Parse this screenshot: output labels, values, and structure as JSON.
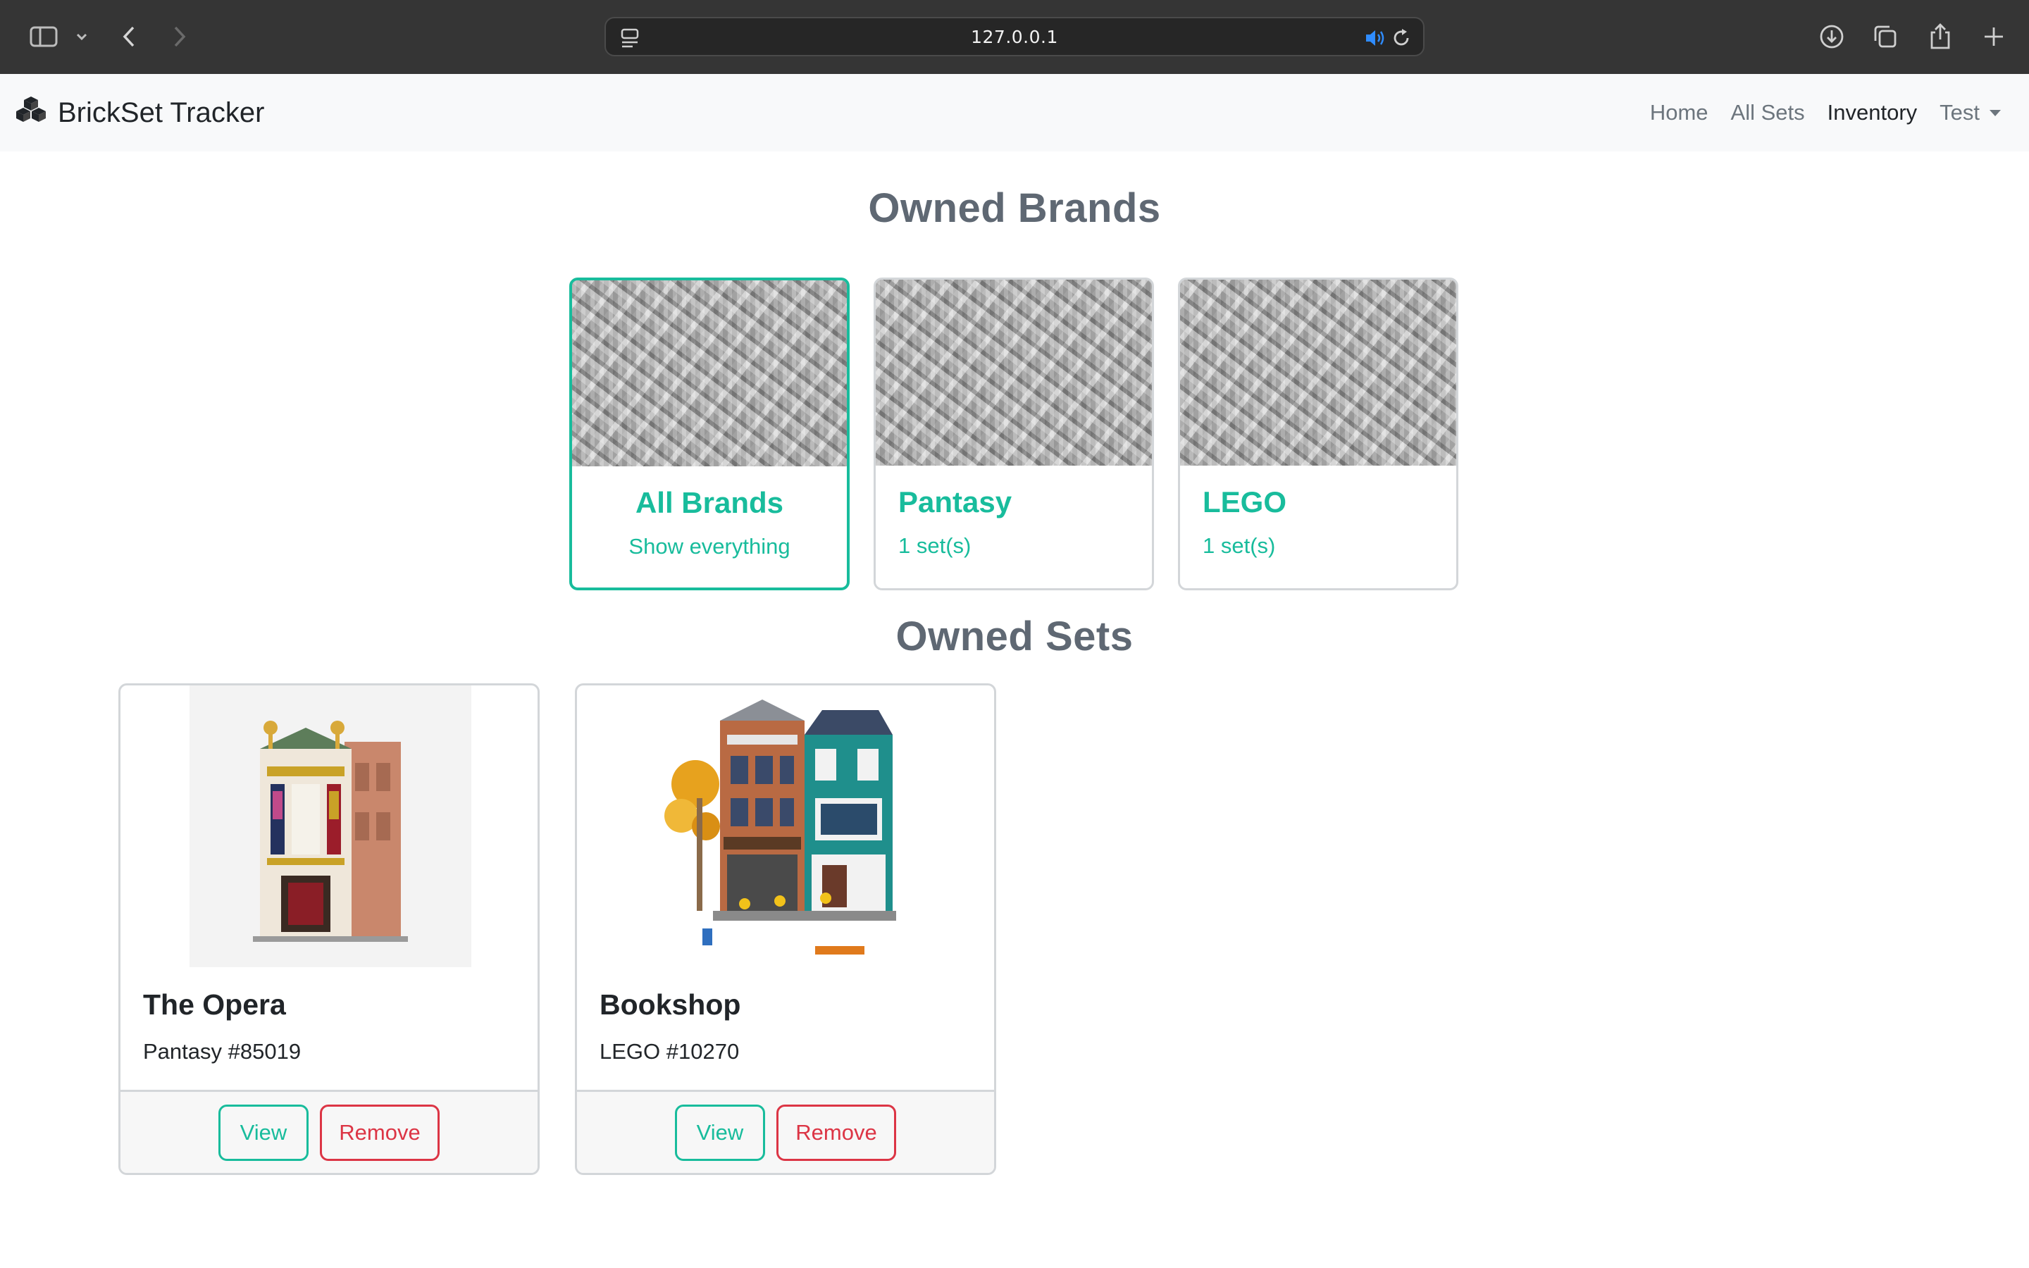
{
  "browser": {
    "url": "127.0.0.1"
  },
  "navbar": {
    "brand_name": "BrickSet Tracker",
    "links": [
      {
        "label": "Home"
      },
      {
        "label": "All Sets"
      },
      {
        "label": "Inventory"
      },
      {
        "label": "Test"
      }
    ],
    "active_link": "Inventory"
  },
  "brands_section": {
    "heading": "Owned Brands",
    "cards": [
      {
        "title": "All Brands",
        "subtitle": "Show everything",
        "selected": true
      },
      {
        "title": "Pantasy",
        "subtitle": "1 set(s)",
        "selected": false
      },
      {
        "title": "LEGO",
        "subtitle": "1 set(s)",
        "selected": false
      }
    ]
  },
  "sets_section": {
    "heading": "Owned Sets",
    "sets": [
      {
        "title": "The Opera",
        "subtitle": "Pantasy #85019",
        "view_label": "View",
        "remove_label": "Remove"
      },
      {
        "title": "Bookshop",
        "subtitle": "LEGO #10270",
        "view_label": "View",
        "remove_label": "Remove"
      }
    ]
  },
  "colors": {
    "accent": "#18bc9c",
    "danger": "#dc3545",
    "heading": "#5f6873",
    "chrome": "#353535"
  }
}
